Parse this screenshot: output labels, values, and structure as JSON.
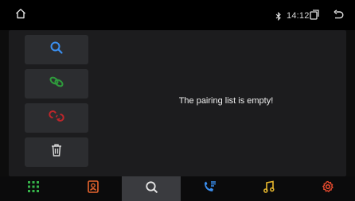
{
  "status_bar": {
    "time": "14:12",
    "icons": [
      "home-icon",
      "bluetooth-icon",
      "recent-apps-icon",
      "back-icon"
    ]
  },
  "side_buttons": [
    {
      "name": "search",
      "icon": "search-icon",
      "color": "#3b8ff0"
    },
    {
      "name": "connect",
      "icon": "link-icon",
      "color": "#2f9a3c"
    },
    {
      "name": "disconnect",
      "icon": "unlink-icon",
      "color": "#c0262b"
    },
    {
      "name": "delete",
      "icon": "trash-icon",
      "color": "#d8d8d8"
    }
  ],
  "main": {
    "message": "The pairing list is empty!"
  },
  "nav": {
    "active": "search",
    "items": [
      {
        "name": "apps",
        "icon": "grid-icon",
        "color": "#36b34a"
      },
      {
        "name": "contacts",
        "icon": "contacts-icon",
        "color": "#e8652e"
      },
      {
        "name": "search",
        "icon": "search-icon",
        "color": "#e6e6e6"
      },
      {
        "name": "calls",
        "icon": "call-log-icon",
        "color": "#3b8ff0"
      },
      {
        "name": "music",
        "icon": "music-icon",
        "color": "#e8b82e"
      },
      {
        "name": "settings",
        "icon": "gear-icon",
        "color": "#e64a2e"
      }
    ]
  },
  "colors": {
    "background": "#0d0d0d",
    "panel": "#1c1c1e",
    "button": "#2c2d30",
    "nav_active": "#3a3b3f"
  }
}
